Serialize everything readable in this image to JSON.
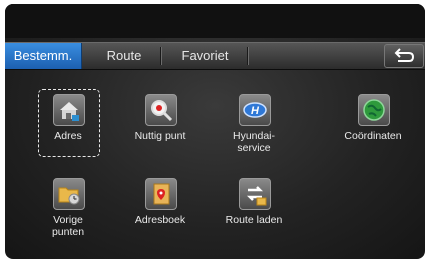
{
  "tabs": [
    {
      "label": "Bestemm.",
      "active": true
    },
    {
      "label": "Route",
      "active": false
    },
    {
      "label": "Favoriet",
      "active": false
    }
  ],
  "back_icon": "back-arrow-icon",
  "menu": {
    "items": [
      {
        "label": "Adres",
        "icon": "house-icon",
        "focused": true
      },
      {
        "label": "Nuttig punt",
        "icon": "magnifier-pin-icon"
      },
      {
        "label": "Hyundai-\nservice",
        "icon": "hyundai-logo-icon"
      },
      {
        "label": "Coördinaten",
        "icon": "globe-icon"
      },
      {
        "label": "Vorige\npunten",
        "icon": "folder-clock-icon"
      },
      {
        "label": "Adresboek",
        "icon": "address-book-icon"
      },
      {
        "label": "Route laden",
        "icon": "route-folder-icon"
      }
    ]
  },
  "colors": {
    "active_tab": "#2a78d0",
    "background": "#232323",
    "text": "#eaeaea"
  }
}
